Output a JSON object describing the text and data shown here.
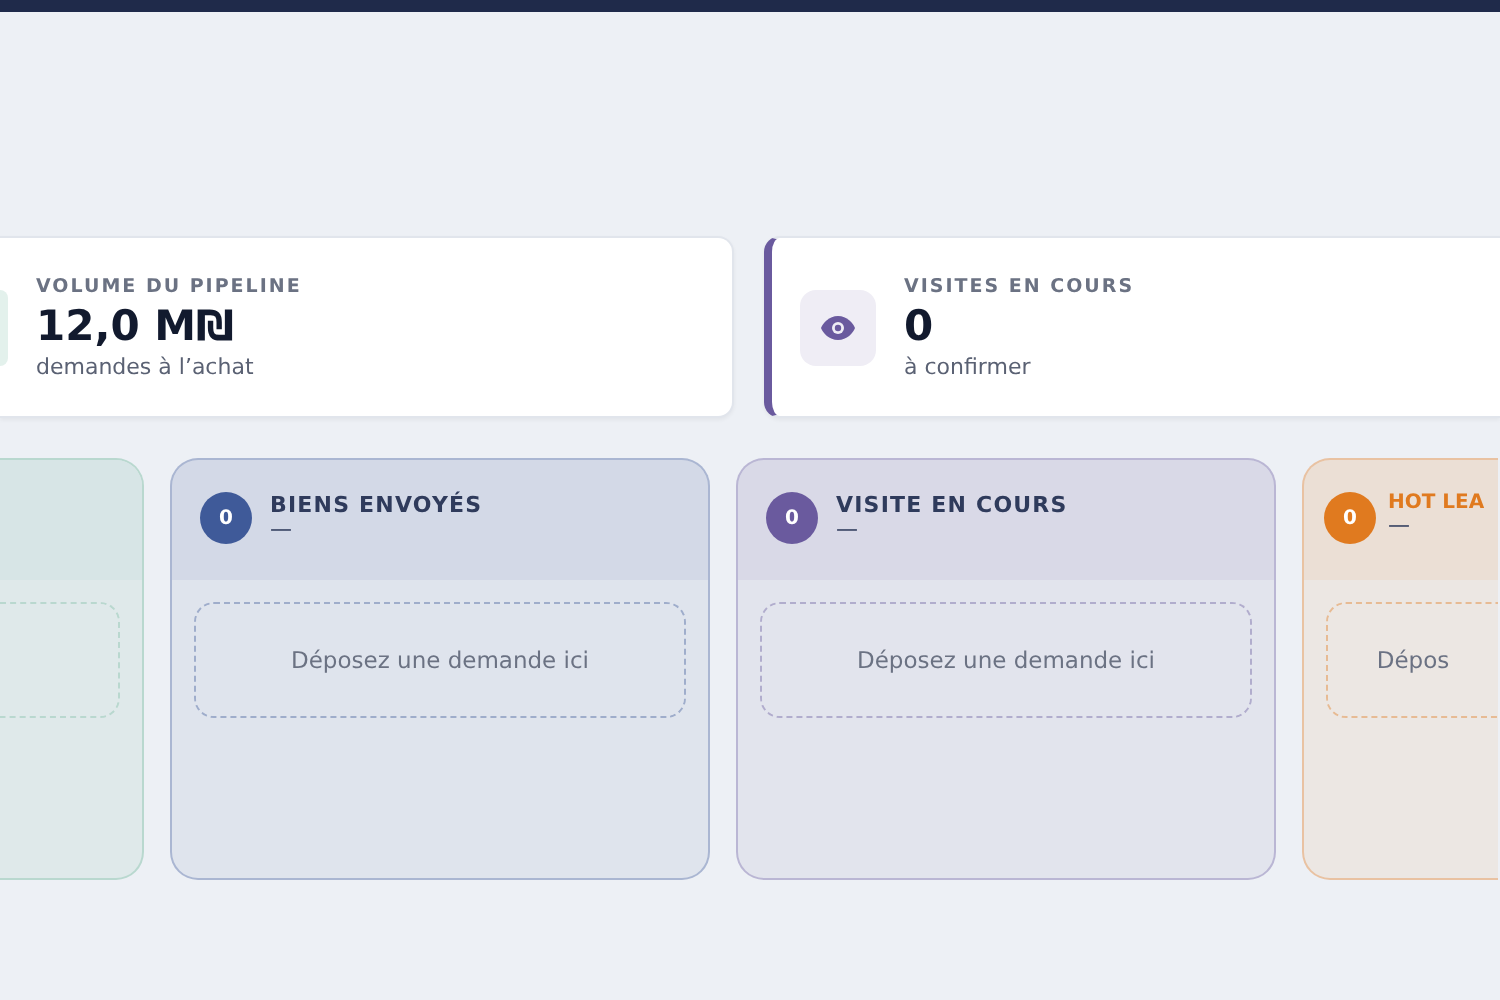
{
  "stats": [
    {
      "kind": "leaf",
      "label": "VOLUME DU PIPELINE",
      "value": "12,0 M₪",
      "caption": "demandes à l’achat",
      "accent": false
    },
    {
      "kind": "eye",
      "label": "VISITES EN COURS",
      "value": "0",
      "caption": "à confirmer",
      "accent": true
    }
  ],
  "columns": [
    {
      "kind": "stub"
    },
    {
      "kind": "full",
      "color": "#3f5a99",
      "badge": "0",
      "title": "BIENS ENVOYÉS",
      "dash": "—",
      "drop": "Déposez une demande ici"
    },
    {
      "kind": "full",
      "color": "#6a5a9e",
      "badge": "0",
      "title": "VISITE EN COURS",
      "dash": "—",
      "drop": "Déposez une demande ici"
    },
    {
      "kind": "edge",
      "color": "#e07a1f",
      "badge": "0",
      "title": "HOT LEA",
      "dash": "—",
      "drop": "Dépos"
    }
  ]
}
